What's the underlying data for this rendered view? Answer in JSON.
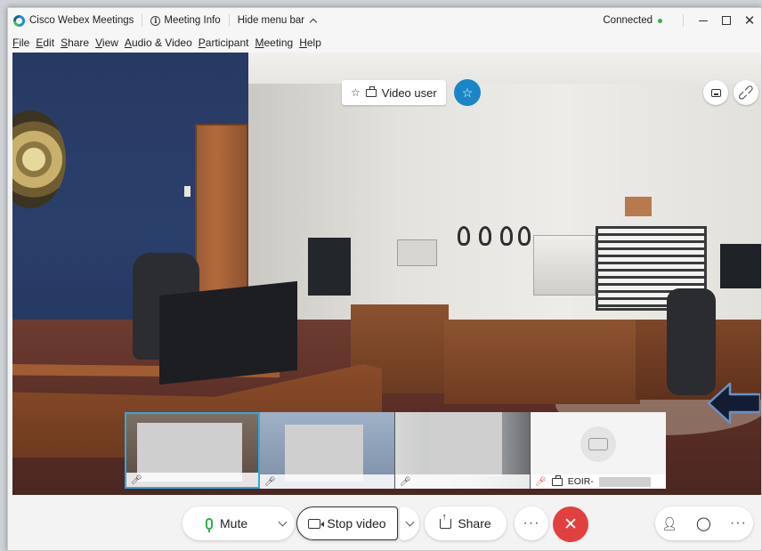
{
  "titlebar": {
    "app_title": "Cisco Webex Meetings",
    "meeting_info": "Meeting Info",
    "hide_menu": "Hide menu bar",
    "status": "Connected",
    "minimize": "—",
    "close": "✕"
  },
  "menu": [
    "File",
    "Edit",
    "Share",
    "View",
    "Audio & Video",
    "Participant",
    "Meeting",
    "Help"
  ],
  "stage": {
    "video_user_label": "Video user"
  },
  "thumbnails": [
    {
      "label": "",
      "mic": "on",
      "active": true
    },
    {
      "label": "",
      "mic": "on",
      "active": false
    },
    {
      "label": "",
      "mic": "on",
      "active": false
    },
    {
      "label": "EOIR-",
      "mic": "muted",
      "active": false
    }
  ],
  "controls": {
    "mute": "Mute",
    "stop_video": "Stop video",
    "share": "Share",
    "more": "···",
    "end": "✕"
  },
  "colors": {
    "accent": "#1a86c7",
    "end_call": "#e2403e",
    "connected": "#37b24d",
    "mic_green": "#2bb04f",
    "active_border": "#2fa8e0"
  }
}
